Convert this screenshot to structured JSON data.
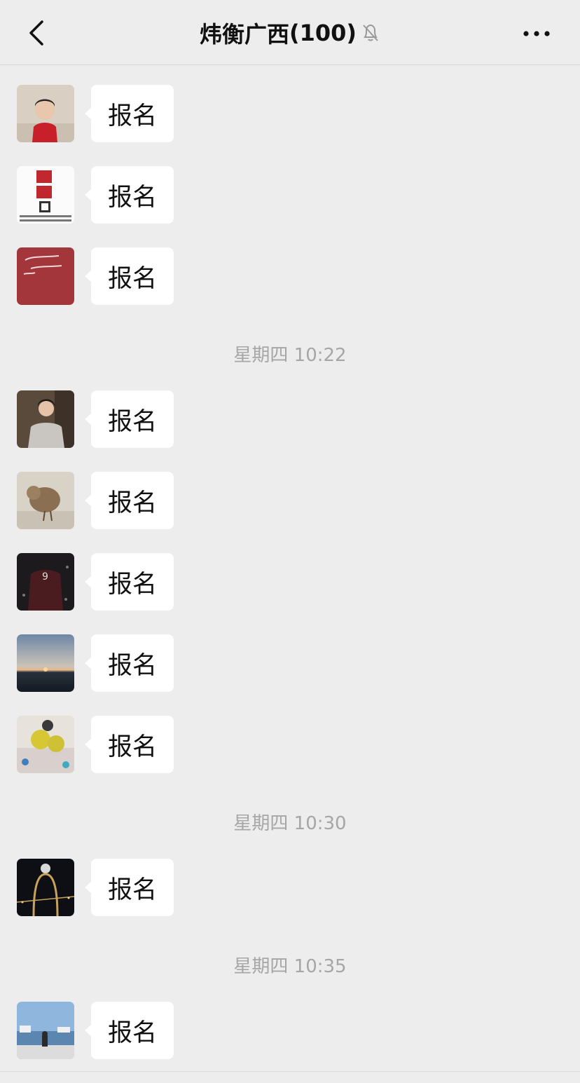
{
  "header": {
    "title": "炜衡广西",
    "member_count": "(100)",
    "back_icon": "chevron-left-icon",
    "mute_icon": "bell-off-icon",
    "more_icon": "more-horizontal-icon"
  },
  "messages": [
    {
      "text": "报名"
    },
    {
      "text": "报名"
    },
    {
      "text": "报名"
    },
    {
      "text": "报名"
    },
    {
      "text": "报名"
    },
    {
      "text": "报名"
    },
    {
      "text": "报名"
    },
    {
      "text": "报名"
    },
    {
      "text": "报名"
    },
    {
      "text": "报名"
    }
  ],
  "timestamps": [
    {
      "text": "星期四 10:22"
    },
    {
      "text": "星期四 10:30"
    },
    {
      "text": "星期四 10:35"
    }
  ],
  "colors": {
    "background": "#ededed",
    "bubble": "#ffffff",
    "timestamp": "#a6a6a6"
  }
}
